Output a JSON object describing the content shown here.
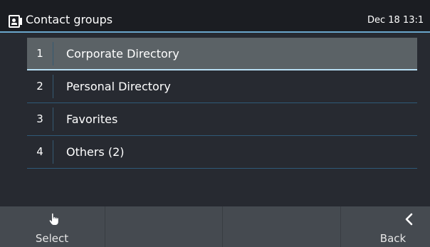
{
  "header": {
    "title": "Contact groups",
    "clock": "Dec 18 13:1"
  },
  "groups": [
    {
      "number": "1",
      "label": "Corporate Directory",
      "selected": true
    },
    {
      "number": "2",
      "label": "Personal Directory",
      "selected": false
    },
    {
      "number": "3",
      "label": "Favorites",
      "selected": false
    },
    {
      "number": "4",
      "label": "Others (2)",
      "selected": false
    }
  ],
  "softkeys": {
    "select": {
      "label": "Select",
      "icon": "hand-pointer-icon"
    },
    "empty2": {
      "label": ""
    },
    "empty3": {
      "label": ""
    },
    "back": {
      "label": "Back",
      "icon": "chevron-left-icon"
    }
  },
  "colors": {
    "background": "#272a31",
    "header": "#1b1d22",
    "accent": "#6aa6cc",
    "selected_row": "#5b6266",
    "softkey_bar": "#454a50"
  }
}
